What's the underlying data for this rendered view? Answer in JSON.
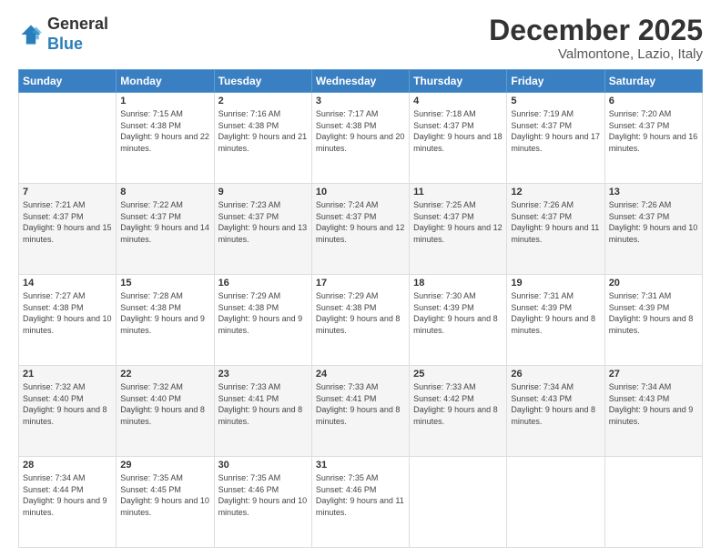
{
  "header": {
    "logo_line1": "General",
    "logo_line2": "Blue",
    "month": "December 2025",
    "location": "Valmontone, Lazio, Italy"
  },
  "weekdays": [
    "Sunday",
    "Monday",
    "Tuesday",
    "Wednesday",
    "Thursday",
    "Friday",
    "Saturday"
  ],
  "weeks": [
    [
      {
        "day": "",
        "sunrise": "",
        "sunset": "",
        "daylight": ""
      },
      {
        "day": "1",
        "sunrise": "Sunrise: 7:15 AM",
        "sunset": "Sunset: 4:38 PM",
        "daylight": "Daylight: 9 hours and 22 minutes."
      },
      {
        "day": "2",
        "sunrise": "Sunrise: 7:16 AM",
        "sunset": "Sunset: 4:38 PM",
        "daylight": "Daylight: 9 hours and 21 minutes."
      },
      {
        "day": "3",
        "sunrise": "Sunrise: 7:17 AM",
        "sunset": "Sunset: 4:38 PM",
        "daylight": "Daylight: 9 hours and 20 minutes."
      },
      {
        "day": "4",
        "sunrise": "Sunrise: 7:18 AM",
        "sunset": "Sunset: 4:37 PM",
        "daylight": "Daylight: 9 hours and 18 minutes."
      },
      {
        "day": "5",
        "sunrise": "Sunrise: 7:19 AM",
        "sunset": "Sunset: 4:37 PM",
        "daylight": "Daylight: 9 hours and 17 minutes."
      },
      {
        "day": "6",
        "sunrise": "Sunrise: 7:20 AM",
        "sunset": "Sunset: 4:37 PM",
        "daylight": "Daylight: 9 hours and 16 minutes."
      }
    ],
    [
      {
        "day": "7",
        "sunrise": "Sunrise: 7:21 AM",
        "sunset": "Sunset: 4:37 PM",
        "daylight": "Daylight: 9 hours and 15 minutes."
      },
      {
        "day": "8",
        "sunrise": "Sunrise: 7:22 AM",
        "sunset": "Sunset: 4:37 PM",
        "daylight": "Daylight: 9 hours and 14 minutes."
      },
      {
        "day": "9",
        "sunrise": "Sunrise: 7:23 AM",
        "sunset": "Sunset: 4:37 PM",
        "daylight": "Daylight: 9 hours and 13 minutes."
      },
      {
        "day": "10",
        "sunrise": "Sunrise: 7:24 AM",
        "sunset": "Sunset: 4:37 PM",
        "daylight": "Daylight: 9 hours and 12 minutes."
      },
      {
        "day": "11",
        "sunrise": "Sunrise: 7:25 AM",
        "sunset": "Sunset: 4:37 PM",
        "daylight": "Daylight: 9 hours and 12 minutes."
      },
      {
        "day": "12",
        "sunrise": "Sunrise: 7:26 AM",
        "sunset": "Sunset: 4:37 PM",
        "daylight": "Daylight: 9 hours and 11 minutes."
      },
      {
        "day": "13",
        "sunrise": "Sunrise: 7:26 AM",
        "sunset": "Sunset: 4:37 PM",
        "daylight": "Daylight: 9 hours and 10 minutes."
      }
    ],
    [
      {
        "day": "14",
        "sunrise": "Sunrise: 7:27 AM",
        "sunset": "Sunset: 4:38 PM",
        "daylight": "Daylight: 9 hours and 10 minutes."
      },
      {
        "day": "15",
        "sunrise": "Sunrise: 7:28 AM",
        "sunset": "Sunset: 4:38 PM",
        "daylight": "Daylight: 9 hours and 9 minutes."
      },
      {
        "day": "16",
        "sunrise": "Sunrise: 7:29 AM",
        "sunset": "Sunset: 4:38 PM",
        "daylight": "Daylight: 9 hours and 9 minutes."
      },
      {
        "day": "17",
        "sunrise": "Sunrise: 7:29 AM",
        "sunset": "Sunset: 4:38 PM",
        "daylight": "Daylight: 9 hours and 8 minutes."
      },
      {
        "day": "18",
        "sunrise": "Sunrise: 7:30 AM",
        "sunset": "Sunset: 4:39 PM",
        "daylight": "Daylight: 9 hours and 8 minutes."
      },
      {
        "day": "19",
        "sunrise": "Sunrise: 7:31 AM",
        "sunset": "Sunset: 4:39 PM",
        "daylight": "Daylight: 9 hours and 8 minutes."
      },
      {
        "day": "20",
        "sunrise": "Sunrise: 7:31 AM",
        "sunset": "Sunset: 4:39 PM",
        "daylight": "Daylight: 9 hours and 8 minutes."
      }
    ],
    [
      {
        "day": "21",
        "sunrise": "Sunrise: 7:32 AM",
        "sunset": "Sunset: 4:40 PM",
        "daylight": "Daylight: 9 hours and 8 minutes."
      },
      {
        "day": "22",
        "sunrise": "Sunrise: 7:32 AM",
        "sunset": "Sunset: 4:40 PM",
        "daylight": "Daylight: 9 hours and 8 minutes."
      },
      {
        "day": "23",
        "sunrise": "Sunrise: 7:33 AM",
        "sunset": "Sunset: 4:41 PM",
        "daylight": "Daylight: 9 hours and 8 minutes."
      },
      {
        "day": "24",
        "sunrise": "Sunrise: 7:33 AM",
        "sunset": "Sunset: 4:41 PM",
        "daylight": "Daylight: 9 hours and 8 minutes."
      },
      {
        "day": "25",
        "sunrise": "Sunrise: 7:33 AM",
        "sunset": "Sunset: 4:42 PM",
        "daylight": "Daylight: 9 hours and 8 minutes."
      },
      {
        "day": "26",
        "sunrise": "Sunrise: 7:34 AM",
        "sunset": "Sunset: 4:43 PM",
        "daylight": "Daylight: 9 hours and 8 minutes."
      },
      {
        "day": "27",
        "sunrise": "Sunrise: 7:34 AM",
        "sunset": "Sunset: 4:43 PM",
        "daylight": "Daylight: 9 hours and 9 minutes."
      }
    ],
    [
      {
        "day": "28",
        "sunrise": "Sunrise: 7:34 AM",
        "sunset": "Sunset: 4:44 PM",
        "daylight": "Daylight: 9 hours and 9 minutes."
      },
      {
        "day": "29",
        "sunrise": "Sunrise: 7:35 AM",
        "sunset": "Sunset: 4:45 PM",
        "daylight": "Daylight: 9 hours and 10 minutes."
      },
      {
        "day": "30",
        "sunrise": "Sunrise: 7:35 AM",
        "sunset": "Sunset: 4:46 PM",
        "daylight": "Daylight: 9 hours and 10 minutes."
      },
      {
        "day": "31",
        "sunrise": "Sunrise: 7:35 AM",
        "sunset": "Sunset: 4:46 PM",
        "daylight": "Daylight: 9 hours and 11 minutes."
      },
      {
        "day": "",
        "sunrise": "",
        "sunset": "",
        "daylight": ""
      },
      {
        "day": "",
        "sunrise": "",
        "sunset": "",
        "daylight": ""
      },
      {
        "day": "",
        "sunrise": "",
        "sunset": "",
        "daylight": ""
      }
    ]
  ]
}
